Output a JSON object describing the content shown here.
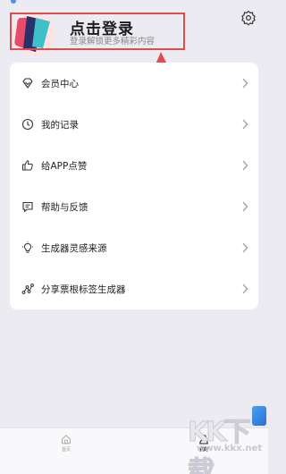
{
  "header": {
    "login_title": "点击登录",
    "login_subtitle": "登录解锁更多精彩内容",
    "settings_icon": "settings-icon"
  },
  "menu": {
    "items": [
      {
        "label": "会员中心",
        "icon": "vip-diamond-icon"
      },
      {
        "label": "我的记录",
        "icon": "clock-icon"
      },
      {
        "label": "给APP点赞",
        "icon": "thumbs-up-icon"
      },
      {
        "label": "帮助与反馈",
        "icon": "feedback-icon"
      },
      {
        "label": "生成器灵感来源",
        "icon": "lightbulb-icon"
      },
      {
        "label": "分享票根标签生成器",
        "icon": "share-icon"
      }
    ]
  },
  "bottom_nav": {
    "tabs": [
      {
        "label": "首页",
        "icon": "home-icon",
        "active": false
      },
      {
        "label": "我的",
        "icon": "user-icon",
        "active": true
      }
    ]
  },
  "watermark": {
    "text": "KK下载",
    "url": "www.kkx.net"
  },
  "colors": {
    "background": "#ecebf1",
    "annotation_red": "#e04b4b",
    "card": "#ffffff"
  }
}
